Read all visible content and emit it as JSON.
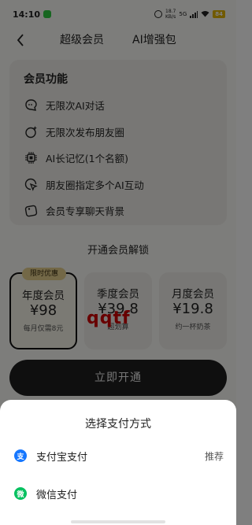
{
  "status_bar": {
    "time": "14:10",
    "net_speed_value": "18.7",
    "net_speed_unit": "KB/s",
    "network": "5G",
    "battery": "84"
  },
  "nav": {
    "tabs": [
      {
        "label": "超级会员",
        "active": true
      },
      {
        "label": "AI增强包",
        "active": false
      }
    ]
  },
  "features": {
    "title": "会员功能",
    "items": [
      {
        "label": "无限次AI对话",
        "icon": "chat-bubble-icon"
      },
      {
        "label": "无限次发布朋友圈",
        "icon": "sparkle-circle-icon"
      },
      {
        "label": "AI长记忆(1个名额)",
        "icon": "chip-icon"
      },
      {
        "label": "朋友圈指定多个AI互动",
        "icon": "cursor-click-icon"
      },
      {
        "label": "会员专享聊天背景",
        "icon": "wallpaper-icon"
      }
    ]
  },
  "plans": {
    "section_title": "开通会员解锁",
    "items": [
      {
        "name": "年度会员",
        "price": "¥98",
        "sub": "每月仅需8元",
        "badge": "限时优惠",
        "selected": true
      },
      {
        "name": "季度会员",
        "price": "¥39.8",
        "sub": "超划算",
        "selected": false
      },
      {
        "name": "月度会员",
        "price": "¥19.8",
        "sub": "约一杯奶茶",
        "selected": false
      }
    ]
  },
  "watermark": "qqtf",
  "open_button": "立即开通",
  "payment_sheet": {
    "title": "选择支付方式",
    "methods": [
      {
        "label": "支付宝支付",
        "tag": "推荐",
        "icon_char": "支",
        "color": "#1677ff"
      },
      {
        "label": "微信支付",
        "tag": "",
        "icon_char": "微",
        "color": "#07c160"
      }
    ]
  },
  "colors": {
    "page_bg": "#fbfbf7",
    "card_bg": "#f0efea",
    "badge_bg": "#e7d08f",
    "button_bg": "#1e1e1e",
    "alipay": "#1677ff",
    "wechat": "#07c160",
    "watermark": "#d10000"
  }
}
